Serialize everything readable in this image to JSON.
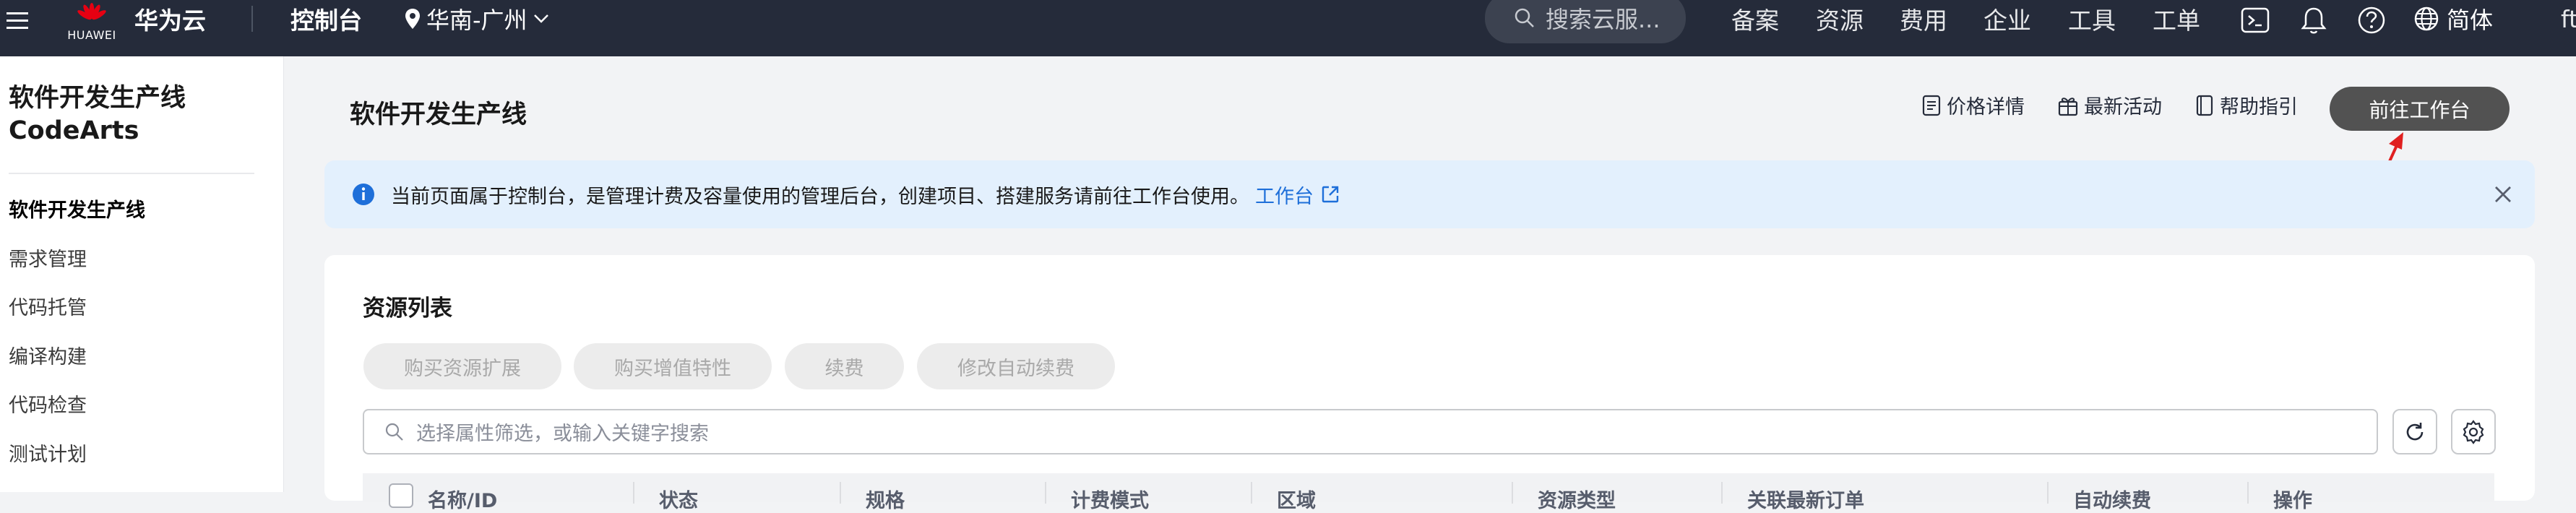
{
  "topbar": {
    "logo_text": "HUAWEI",
    "brand": "华为云",
    "console": "控制台",
    "region": "华南-广州",
    "search_placeholder": "搜索云服...",
    "nav": [
      "备案",
      "资源",
      "费用",
      "企业",
      "工具",
      "工单"
    ],
    "language": "简体",
    "user_truncated": "ft"
  },
  "sidebar": {
    "title_line1": "软件开发生产线",
    "title_line2": "CodeArts",
    "items": [
      "软件开发生产线",
      "需求管理",
      "代码托管",
      "编译构建",
      "代码检查",
      "测试计划"
    ],
    "active_index": 0
  },
  "header": {
    "title": "软件开发生产线",
    "links": [
      "价格详情",
      "最新活动",
      "帮助指引"
    ],
    "goto_button": "前往工作台"
  },
  "banner": {
    "text": "当前页面属于控制台，是管理计费及容量使用的管理后台，创建项目、搭建服务请前往工作台使用。",
    "link": "工作台"
  },
  "resources": {
    "title": "资源列表",
    "actions": [
      "购买资源扩展",
      "购买增值特性",
      "续费",
      "修改自动续费"
    ],
    "filter_placeholder": "选择属性筛选，或输入关键字搜索",
    "columns": [
      "名称/ID",
      "状态",
      "规格",
      "计费模式",
      "区域",
      "资源类型",
      "关联最新订单",
      "自动续费",
      "操作"
    ]
  },
  "colors": {
    "topbar_bg": "#252b3a",
    "accent_link": "#1e6fd9",
    "banner_bg": "#e3f0fd",
    "primary_button": "#525252",
    "annotation_arrow": "#e02020"
  }
}
